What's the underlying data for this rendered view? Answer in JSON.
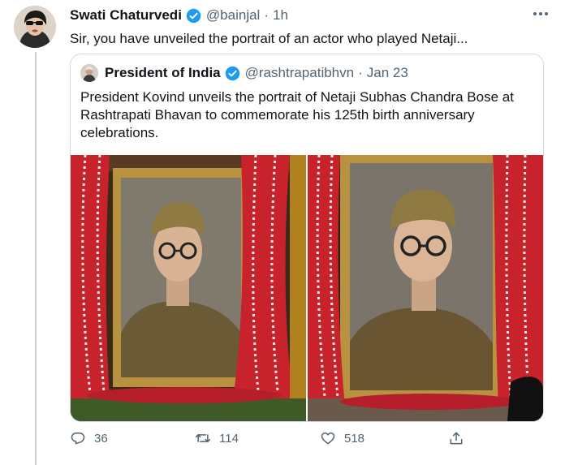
{
  "tweet": {
    "author_name": "Swati Chaturvedi",
    "handle": "@bainjal",
    "time": "1h",
    "text": "Sir, you have unveiled the portrait of an actor who played Netaji..."
  },
  "quoted_tweet": {
    "author_name": "President of India",
    "handle": "@rashtrapatibhvn",
    "time": "Jan 23",
    "text": "President Kovind unveils the portrait of Netaji Subhas Chandra Bose at Rashtrapati Bhavan to commemorate his 125th birth anniversary celebrations."
  },
  "actions": {
    "reply_count": "36",
    "retweet_count": "114",
    "like_count": "518"
  },
  "colors": {
    "verified": "#1d9bf0",
    "muted_text": "#536471",
    "border": "#cfd9de",
    "curtain_red": "#c8232c"
  },
  "icons": [
    "verified-badge-icon",
    "more-icon",
    "reply-icon",
    "retweet-icon",
    "like-icon",
    "share-icon"
  ]
}
